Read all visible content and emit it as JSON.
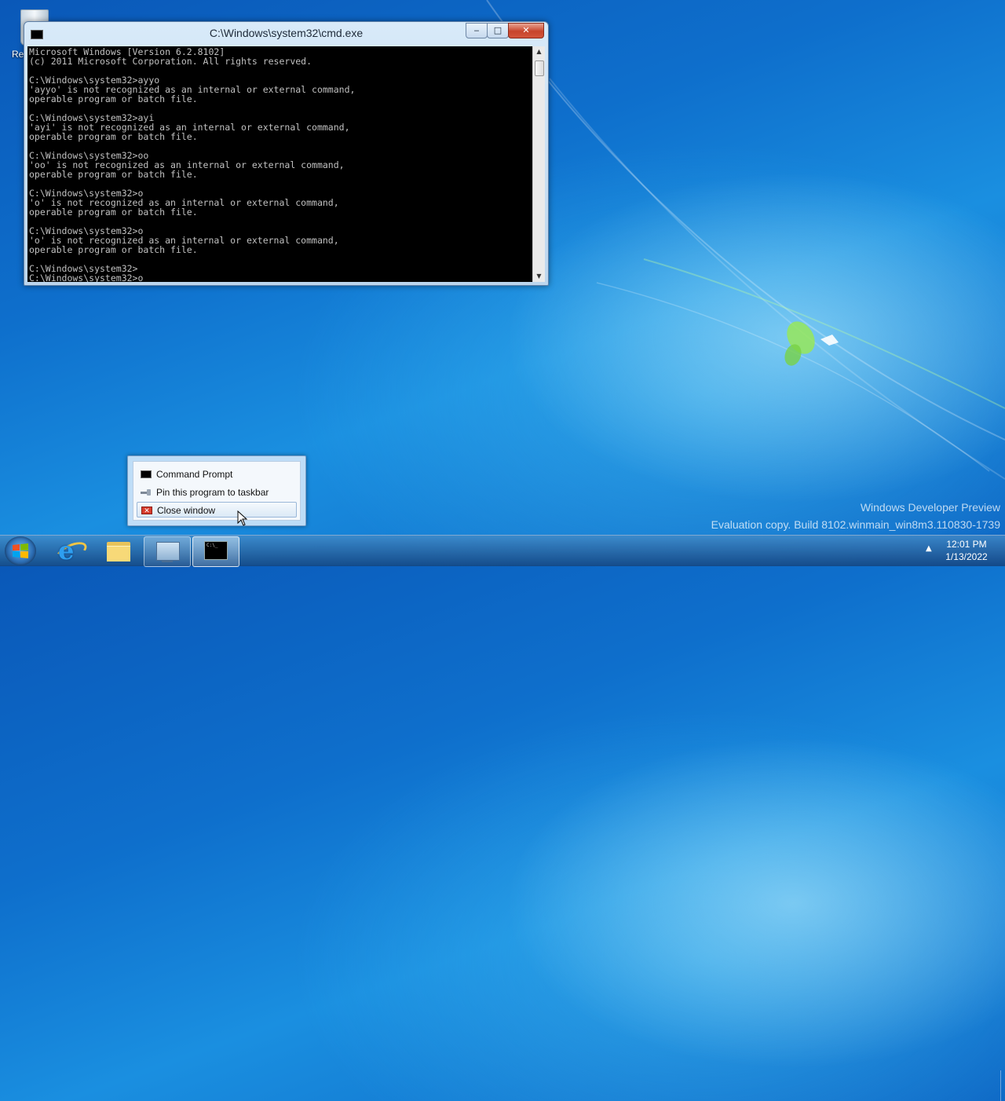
{
  "desktop": {
    "recycle_bin_label": "Recy",
    "watermark_line1": "Windows Developer Preview",
    "watermark_line2": "Evaluation copy. Build 8102.winmain_win8m3.110830-1739"
  },
  "cmd_window": {
    "title": "C:\\Windows\\system32\\cmd.exe",
    "buttons": {
      "minimize": "‒",
      "maximize": "□",
      "close": "✕"
    },
    "console_lines": [
      "Microsoft Windows [Version 6.2.8102]",
      "(c) 2011 Microsoft Corporation. All rights reserved.",
      "",
      "C:\\Windows\\system32>ayyo",
      "'ayyo' is not recognized as an internal or external command,",
      "operable program or batch file.",
      "",
      "C:\\Windows\\system32>ayi",
      "'ayi' is not recognized as an internal or external command,",
      "operable program or batch file.",
      "",
      "C:\\Windows\\system32>oo",
      "'oo' is not recognized as an internal or external command,",
      "operable program or batch file.",
      "",
      "C:\\Windows\\system32>o",
      "'o' is not recognized as an internal or external command,",
      "operable program or batch file.",
      "",
      "C:\\Windows\\system32>o",
      "'o' is not recognized as an internal or external command,",
      "operable program or batch file.",
      "",
      "C:\\Windows\\system32>",
      "C:\\Windows\\system32>o"
    ],
    "scroll_up_glyph": "▲",
    "scroll_down_glyph": "▼"
  },
  "jumplist": {
    "items": [
      {
        "label": "Command Prompt",
        "icon": "cmd-icon"
      },
      {
        "label": "Pin this program to taskbar",
        "icon": "pin-icon"
      },
      {
        "label": "Close window",
        "icon": "close-icon"
      }
    ],
    "close_glyph": "✕"
  },
  "taskbar": {
    "buttons": [
      {
        "name": "internet-explorer",
        "icon": "ie-icon"
      },
      {
        "name": "file-explorer",
        "icon": "folder-icon"
      },
      {
        "name": "performance-monitor",
        "icon": "monitor-icon"
      },
      {
        "name": "command-prompt",
        "icon": "cmd-icon"
      }
    ],
    "ie_glyph": "e",
    "cmd_glyph": "C:\\_",
    "tray_arrow": "▲",
    "time": "12:01 PM",
    "date": "1/13/2022"
  }
}
